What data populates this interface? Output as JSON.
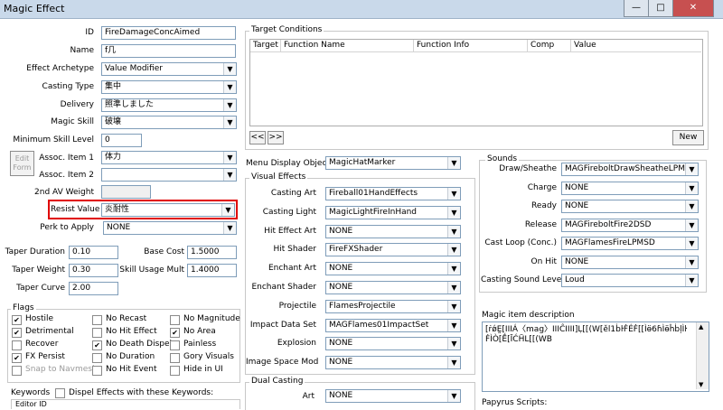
{
  "window": {
    "title": "Magic Effect",
    "min": "—",
    "max": "□",
    "close": "✕"
  },
  "left": {
    "id_label": "ID",
    "id_value": "FireDamageConcAimed",
    "name_label": "Name",
    "name_value": "f几",
    "archetype_label": "Effect Archetype",
    "archetype_value": "Value Modifier",
    "casting_type_label": "Casting Type",
    "casting_type_value": "集中",
    "delivery_label": "Delivery",
    "delivery_value": "照準しました",
    "magic_skill_label": "Magic Skill",
    "magic_skill_value": "破壊",
    "min_skill_label": "Minimum Skill Level",
    "min_skill_value": "0",
    "edit_form_label": "Edit Form",
    "assoc1_label": "Assoc. Item 1",
    "assoc1_value": "体力",
    "assoc2_label": "Assoc. Item 2",
    "assoc2_value": "",
    "av2_label": "2nd AV Weight",
    "av2_value": "",
    "resist_label": "Resist Value",
    "resist_value": "炎耐性",
    "perk_label": "Perk to Apply",
    "perk_value": "NONE",
    "taper_duration_label": "Taper Duration",
    "taper_duration_value": "0.10",
    "base_cost_label": "Base Cost",
    "base_cost_value": "1.5000",
    "taper_weight_label": "Taper Weight",
    "taper_weight_value": "0.30",
    "skill_mult_label": "Skill Usage Mult",
    "skill_mult_value": "1.4000",
    "taper_curve_label": "Taper Curve",
    "taper_curve_value": "2.00"
  },
  "flags": {
    "title": "Flags",
    "items": [
      {
        "label": "Hostile",
        "checked": "✔"
      },
      {
        "label": "No Recast",
        "checked": ""
      },
      {
        "label": "No Magnitude",
        "checked": ""
      },
      {
        "label": "Detrimental",
        "checked": "✔"
      },
      {
        "label": "No Hit Effect",
        "checked": ""
      },
      {
        "label": "No Area",
        "checked": "✔"
      },
      {
        "label": "Recover",
        "checked": ""
      },
      {
        "label": "No Death Dispel",
        "checked": "✔"
      },
      {
        "label": "Painless",
        "checked": ""
      },
      {
        "label": "FX Persist",
        "checked": "✔"
      },
      {
        "label": "No Duration",
        "checked": ""
      },
      {
        "label": "Gory Visuals",
        "checked": ""
      },
      {
        "label": "Snap to Navmesh",
        "checked": ""
      },
      {
        "label": "No Hit Event",
        "checked": ""
      },
      {
        "label": "Hide in UI",
        "checked": ""
      }
    ]
  },
  "keywords": {
    "title": "Keywords",
    "dispel_label": "Dispel Effects with these Keywords:",
    "col_editor_id": "Editor ID"
  },
  "target_conditions": {
    "title": "Target Conditions",
    "columns": [
      "Target",
      "Function Name",
      "Function Info",
      "Comp",
      "Value"
    ],
    "prev_label": "<<",
    "next_label": ">>",
    "new_label": "New"
  },
  "menu_display": {
    "label": "Menu Display Object",
    "value": "MagicHatMarker"
  },
  "visual_effects": {
    "title": "Visual Effects",
    "rows": [
      {
        "label": "Casting Art",
        "value": "Fireball01HandEffects"
      },
      {
        "label": "Casting Light",
        "value": "MagicLightFireInHand"
      },
      {
        "label": "Hit Effect Art",
        "value": "NONE"
      },
      {
        "label": "Hit Shader",
        "value": "FireFXShader"
      },
      {
        "label": "Enchant Art",
        "value": "NONE"
      },
      {
        "label": "Enchant Shader",
        "value": "NONE"
      },
      {
        "label": "Projectile",
        "value": "FlamesProjectile"
      },
      {
        "label": "Impact Data Set",
        "value": "MAGFlames01ImpactSet"
      },
      {
        "label": "Explosion",
        "value": "NONE"
      },
      {
        "label": "Image Space Mod",
        "value": "NONE"
      }
    ]
  },
  "dual_casting": {
    "title": "Dual Casting",
    "art_label": "Art",
    "art_value": "NONE"
  },
  "sounds": {
    "title": "Sounds",
    "rows": [
      {
        "label": "Draw/Sheathe",
        "value": "MAGFireboltDrawSheatheLPMSD"
      },
      {
        "label": "Charge",
        "value": "NONE"
      },
      {
        "label": "Ready",
        "value": "NONE"
      },
      {
        "label": "Release",
        "value": "MAGFireboltFire2DSD"
      },
      {
        "label": "Cast Loop (Conc.)",
        "value": "MAGFlamesFireLPMSD"
      },
      {
        "label": "On Hit",
        "value": "NONE"
      },
      {
        "label": "Casting Sound Level",
        "value": "Loud"
      }
    ]
  },
  "description": {
    "title": "Magic item description",
    "text": "[ṙǿḚ[IIIÁ〈mag〉IIIĈIIII]Ḷ[[(W[ěl1ḃŀḞÉḞ[[Ìӫ6ɦÌӫĥḃļÌŀḞÌÒ[Ḗ[ĪĆḦL[[(WB"
  },
  "papyrus": {
    "title": "Papyrus Scripts:"
  },
  "colors": {
    "highlight": "#e00000",
    "titlebar": "#c9d9ea"
  }
}
